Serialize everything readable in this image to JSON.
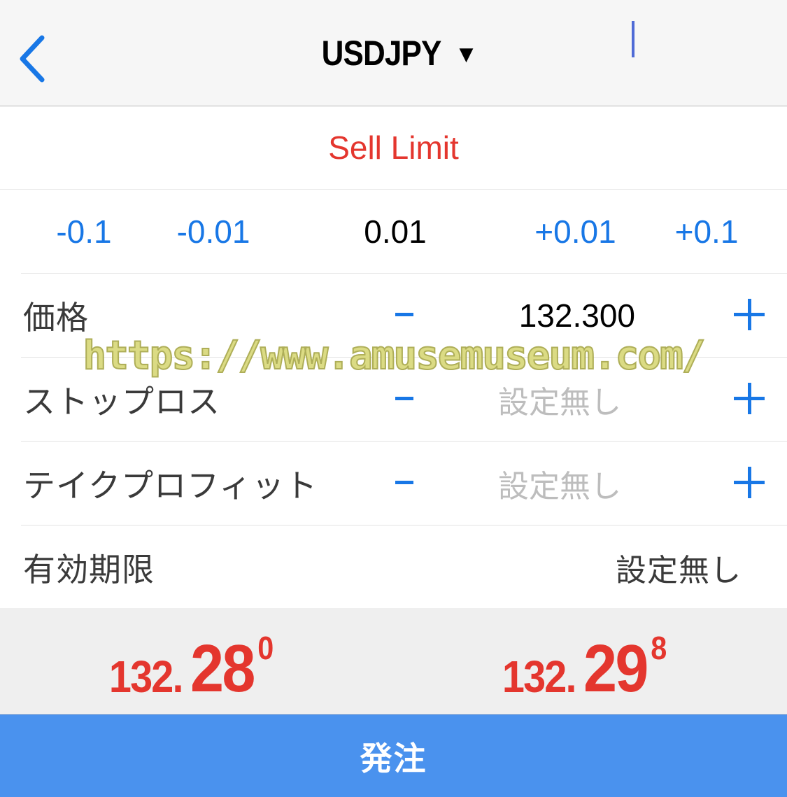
{
  "nav": {
    "symbol": "USDJPY",
    "caret": "▼"
  },
  "order_type": "Sell Limit",
  "steps": [
    "-0.1",
    "-0.01",
    "0.01",
    "+0.01",
    "+0.1"
  ],
  "rows": {
    "price": {
      "label": "価格",
      "value": "132.300"
    },
    "stop_loss": {
      "label": "ストップロス",
      "value": "設定無し"
    },
    "take_profit": {
      "label": "テイクプロフィット",
      "value": "設定無し"
    },
    "expiry": {
      "label": "有効期限",
      "value": "設定無し"
    }
  },
  "watermark": "https://www.amusemuseum.com/",
  "quotes": {
    "bid": {
      "prefix": "132.",
      "big": "28",
      "sup": "0"
    },
    "ask": {
      "prefix": "132.",
      "big": "29",
      "sup": "8"
    }
  },
  "submit_label": "発注",
  "colors": {
    "accent_blue": "#1877e6",
    "sell_red": "#e4362e",
    "submit_blue": "#4a92ee"
  }
}
